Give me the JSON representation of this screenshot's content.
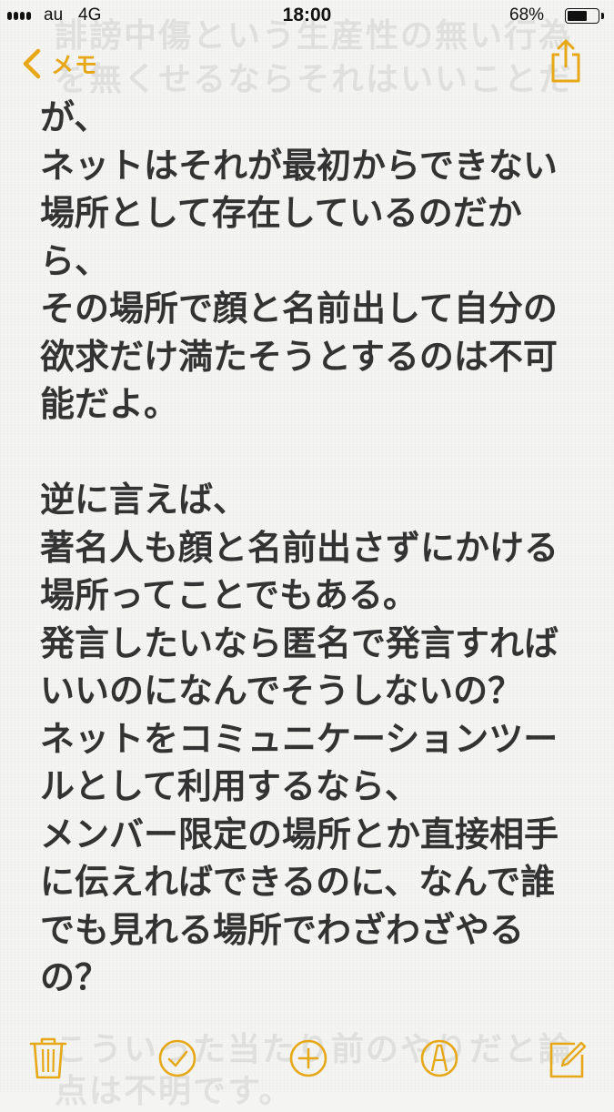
{
  "status_bar": {
    "carrier": "au",
    "network": "4G",
    "time": "18:00",
    "battery_percent": "68%",
    "battery_level": 0.68
  },
  "ghost_text": {
    "top_line_1": "誹謗中傷という生産性の無い行為",
    "top_line_2": "を無くせるならそれはいいことだ",
    "bottom_line_1": "こういった当たり前のやりだと論",
    "bottom_line_2": "点は不明です。"
  },
  "nav": {
    "back_label": "メモ",
    "back_icon": "chevron-left-icon",
    "share_icon": "share-icon"
  },
  "note": {
    "lines": [
      "が、",
      "ネットはそれが最初からできない",
      "場所として存在しているのだか",
      "ら、",
      "その場所で顔と名前出して自分の",
      "欲求だけ満たそうとするのは不可",
      "能だよ。",
      "",
      "逆に言えば、",
      "著名人も顔と名前出さずにかける",
      "場所ってことでもある。",
      "発言したいなら匿名で発言すれば",
      "いいのになんでそうしないの？",
      "ネットをコミュニケーションツー",
      "ルとして利用するなら、",
      "メンバー限定の場所とか直接相手",
      "に伝えればできるのに、なんで誰",
      "でも見れる場所でわざわざやる",
      "の？"
    ]
  },
  "toolbar": {
    "icons": [
      "trash-icon",
      "checklist-icon",
      "add-icon",
      "markup-icon",
      "compose-icon"
    ]
  },
  "colors": {
    "accent": "#e6a817",
    "text": "#333333",
    "background": "#f4f4f2"
  }
}
